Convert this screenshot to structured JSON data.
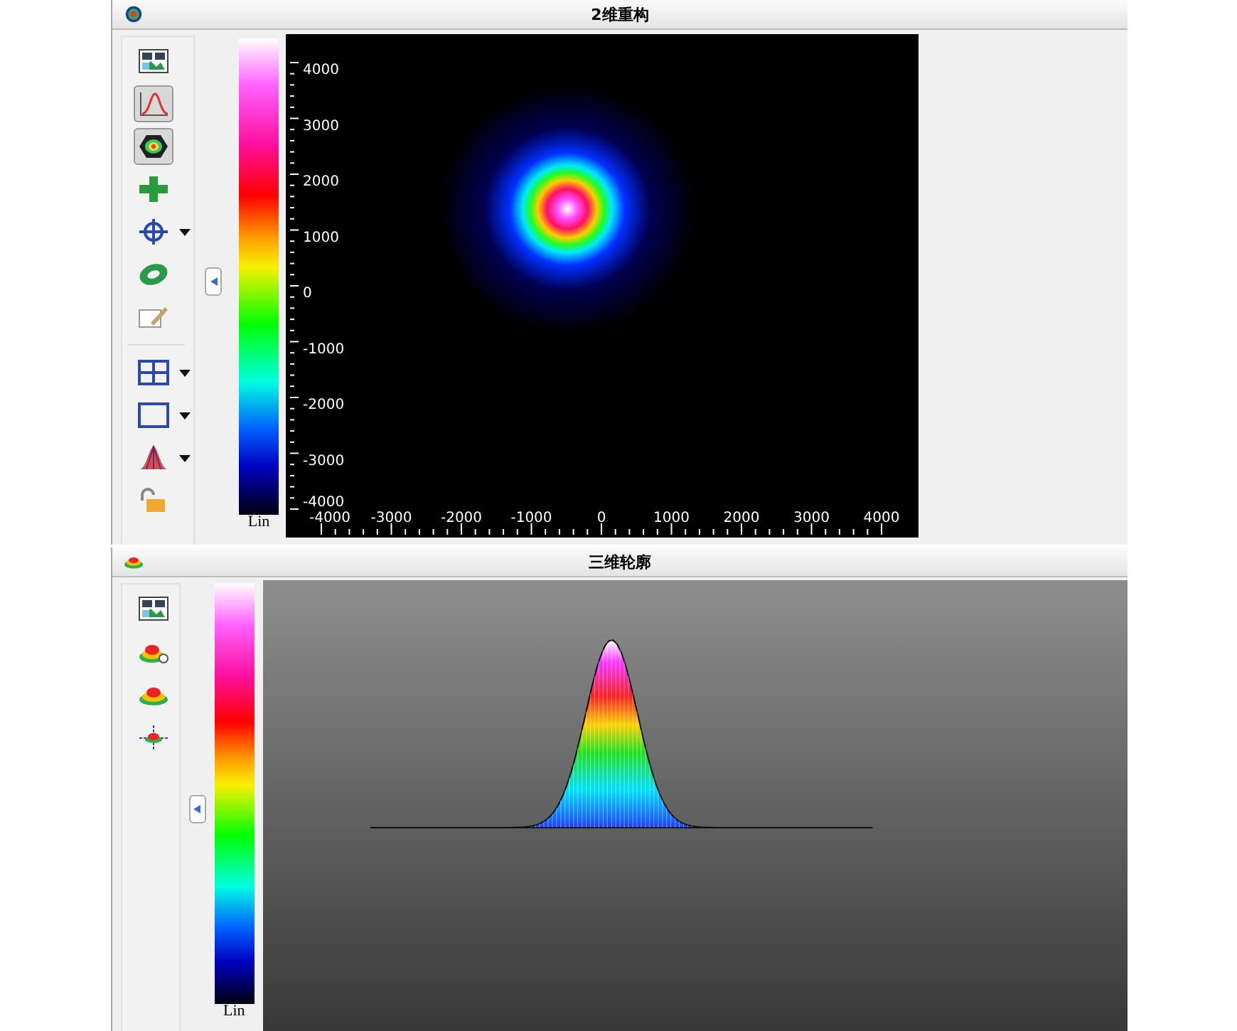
{
  "top_window": {
    "title": "2维重构",
    "tools": [
      {
        "kind": "image",
        "selected": false,
        "dropdown": false
      },
      {
        "kind": "profile",
        "selected": true,
        "dropdown": false
      },
      {
        "kind": "hexagon",
        "selected": true,
        "dropdown": false
      },
      {
        "kind": "plus",
        "selected": false,
        "dropdown": false
      },
      {
        "kind": "crosshair",
        "selected": false,
        "dropdown": true
      },
      {
        "kind": "ring",
        "selected": false,
        "dropdown": false
      },
      {
        "kind": "edit",
        "selected": false,
        "dropdown": false
      },
      {
        "kind": "separator"
      },
      {
        "kind": "grid",
        "selected": false,
        "dropdown": true
      },
      {
        "kind": "rect",
        "selected": false,
        "dropdown": true
      },
      {
        "kind": "peak",
        "selected": false,
        "dropdown": true
      },
      {
        "kind": "lock",
        "selected": false,
        "dropdown": false
      }
    ],
    "colorbar": {
      "label": "Lin"
    },
    "plot": {
      "y_ticks": [
        "4000",
        "3000",
        "2000",
        "1000",
        "0",
        "-1000",
        "-2000",
        "-3000",
        "-4000"
      ],
      "x_ticks": [
        "-4000",
        "-3000",
        "-2000",
        "-1000",
        "0",
        "1000",
        "2000",
        "3000",
        "4000"
      ]
    }
  },
  "bottom_window": {
    "title": "三维轮廓",
    "tools": [
      {
        "kind": "image",
        "selected": false,
        "dropdown": false
      },
      {
        "kind": "surface-gear",
        "selected": false,
        "dropdown": false
      },
      {
        "kind": "surface",
        "selected": false,
        "dropdown": false
      },
      {
        "kind": "surface-move",
        "selected": false,
        "dropdown": false
      }
    ],
    "colorbar": {
      "label": "Lin"
    }
  }
}
